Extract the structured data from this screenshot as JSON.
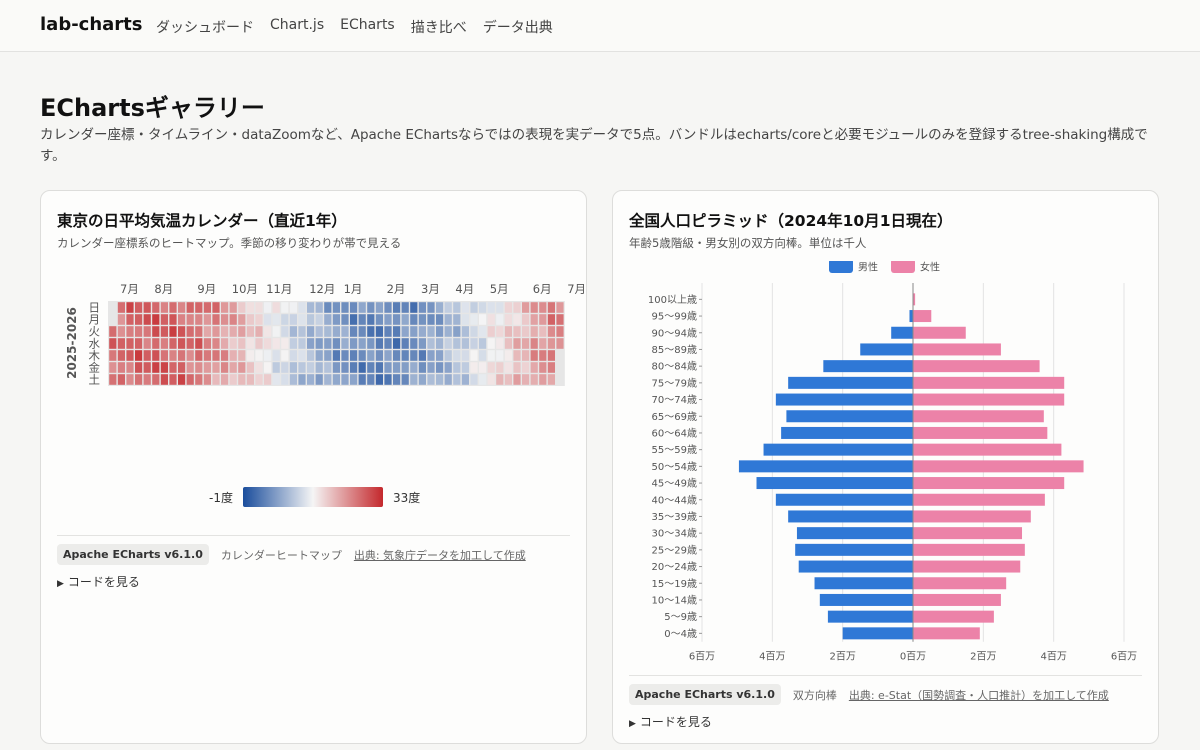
{
  "header": {
    "brand": "lab-charts",
    "nav": [
      "ダッシュボード",
      "Chart.js",
      "ECharts",
      "描き比べ",
      "データ出典"
    ]
  },
  "page": {
    "title": "EChartsギャラリー",
    "description": "カレンダー座標・タイムライン・dataZoomなど、Apache EChartsならではの表現を実データで5点。バンドルはecharts/coreと必要モジュールのみを登録するtree-shaking構成です。"
  },
  "cards": [
    {
      "title": "東京の日平均気温カレンダー（直近1年）",
      "subtitle": "カレンダー座標系のヒートマップ。季節の移り変わりが帯で見える",
      "badge": "Apache ECharts v6.1.0",
      "kind": "カレンダーヒートマップ",
      "source": "出典: 気象庁データを加工して作成",
      "code": "コードを見る"
    },
    {
      "title": "全国人口ピラミッド（2024年10月1日現在）",
      "subtitle": "年齢5歳階級・男女別の双方向棒。単位は千人",
      "badge": "Apache ECharts v6.1.0",
      "kind": "双方向棒",
      "source": "出典: e-Stat（国勢調査・人口推計）を加工して作成",
      "code": "コードを見る"
    }
  ],
  "chart_data": [
    {
      "type": "heatmap",
      "year_label": "2025-2026",
      "month_labels": [
        "7月",
        "8月",
        "9月",
        "10月",
        "11月",
        "12月",
        "1月",
        "2月",
        "3月",
        "4月",
        "5月",
        "6月",
        "7月"
      ],
      "weekday_labels": [
        "日",
        "月",
        "火",
        "水",
        "木",
        "金",
        "土"
      ],
      "visual_map": {
        "min": -1,
        "max": 33,
        "min_label": "-1度",
        "max_label": "33度"
      },
      "colors": {
        "cold": "#1a4d9c",
        "mid": "#f5f5f5",
        "hot": "#c4282c"
      }
    },
    {
      "type": "bar",
      "legend": [
        {
          "name": "男性",
          "color": "#2f78d6"
        },
        {
          "name": "女性",
          "color": "#ec82a8"
        }
      ],
      "categories": [
        "100以上歳",
        "95〜99歳",
        "90〜94歳",
        "85〜89歳",
        "80〜84歳",
        "75〜79歳",
        "70〜74歳",
        "65〜69歳",
        "60〜64歳",
        "55〜59歳",
        "50〜54歳",
        "45〜49歳",
        "40〜44歳",
        "35〜39歳",
        "30〜34歳",
        "25〜29歳",
        "20〜24歳",
        "15〜19歳",
        "10〜14歳",
        "5〜9歳",
        "0〜4歳"
      ],
      "series": [
        {
          "name": "男性",
          "values": [
            -0.01,
            -0.1,
            -0.62,
            -1.5,
            -2.55,
            -3.55,
            -3.9,
            -3.6,
            -3.75,
            -4.25,
            -4.95,
            -4.45,
            -3.9,
            -3.55,
            -3.3,
            -3.35,
            -3.25,
            -2.8,
            -2.65,
            -2.42,
            -2.0
          ]
        },
        {
          "name": "女性",
          "values": [
            0.06,
            0.52,
            1.5,
            2.5,
            3.6,
            4.3,
            4.3,
            3.72,
            3.82,
            4.22,
            4.85,
            4.3,
            3.75,
            3.35,
            3.1,
            3.18,
            3.05,
            2.65,
            2.5,
            2.3,
            1.9
          ]
        }
      ],
      "xlim": [
        -6,
        6
      ],
      "tick_labels": [
        "6百万",
        "4百万",
        "2百万",
        "0百万",
        "2百万",
        "4百万",
        "6百万"
      ]
    }
  ]
}
